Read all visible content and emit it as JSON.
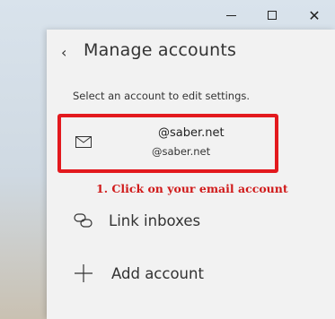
{
  "window": {
    "minimize_icon": "minimize-icon",
    "maximize_icon": "maximize-icon",
    "close_glyph": "✕"
  },
  "panel": {
    "back_glyph": "‹",
    "title": "Manage accounts",
    "subtitle": "Select an account to edit settings.",
    "account": {
      "line1": "@saber.net",
      "line2": "@saber.net",
      "icon": "mail-icon"
    },
    "annotation": "1. Click on your email account",
    "items": [
      {
        "label": "Link inboxes",
        "icon": "link-icon"
      },
      {
        "label": "Add account",
        "icon": "plus-icon"
      }
    ]
  },
  "colors": {
    "highlight": "#e3191e",
    "annotation": "#d01a1a",
    "panel_bg": "#f2f2f2"
  }
}
